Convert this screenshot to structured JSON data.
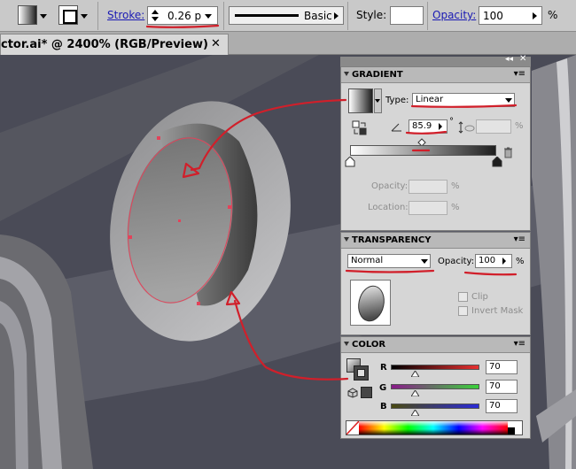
{
  "control_bar": {
    "stroke_label": "Stroke:",
    "stroke_weight": "0.26 p",
    "brush_label": "Basic",
    "style_label": "Style:",
    "opacity_label": "Opacity:",
    "opacity_value": "100",
    "opacity_unit": "%"
  },
  "document": {
    "tab_title": "ctor.ai* @ 2400% (RGB/Preview)",
    "close_glyph": "✕"
  },
  "gradient_panel": {
    "title": "GRADIENT",
    "type_label": "Type:",
    "type_value": "Linear",
    "angle_value": "85.9",
    "angle_unit": "°",
    "aspect_unit": "%",
    "opacity_label": "Opacity:",
    "opacity_unit": "%",
    "location_label": "Location:",
    "location_unit": "%"
  },
  "transparency_panel": {
    "title": "TRANSPARENCY",
    "blend_mode": "Normal",
    "opacity_label": "Opacity:",
    "opacity_value": "100",
    "opacity_unit": "%",
    "clip_label": "Clip",
    "invert_mask_label": "Invert Mask"
  },
  "color_panel": {
    "title": "COLOR",
    "r_label": "R",
    "r_value": "70",
    "g_label": "G",
    "g_value": "70",
    "b_label": "B",
    "b_value": "70"
  },
  "colors": {
    "canvas_bg": "#4a4b57",
    "panel_bg": "#d6d6d6",
    "annotation_red": "#d11f2a",
    "link_blue": "#1a1ab4"
  },
  "icons": [
    "double-arrow-collapse-icon",
    "panel-close-icon",
    "flyout-menu-icon",
    "reverse-gradient-icon",
    "angle-icon",
    "aspect-ratio-icon",
    "trash-icon",
    "default-colors-icon",
    "stroke-fill-swap-icon",
    "none-swatch-icon",
    "spin-arrows-icon"
  ]
}
